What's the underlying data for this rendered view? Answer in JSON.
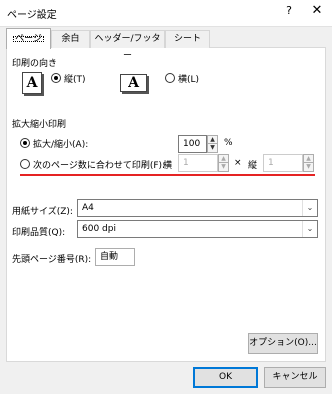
{
  "window": {
    "title": "ページ設定",
    "help": "?",
    "close": "✕"
  },
  "tabs": [
    {
      "label": "ページ"
    },
    {
      "label": "余白"
    },
    {
      "label": "ヘッダー/フッター"
    },
    {
      "label": "シート"
    }
  ],
  "orientation": {
    "heading": "印刷の向き",
    "portrait_icon": "A",
    "portrait_label": "縦(T)",
    "landscape_icon": "A",
    "landscape_label": "横(L)"
  },
  "scaling": {
    "heading": "拡大縮小印刷",
    "zoom_label": "拡大/縮小(A):",
    "zoom_value": "100",
    "zoom_unit": "%",
    "fit_label": "次のページ数に合わせて印刷(F):",
    "wide_label": "横",
    "wide_value": "1",
    "times": "×",
    "tall_label": "縦",
    "tall_value": "1"
  },
  "paper": {
    "label": "用紙サイズ(Z):",
    "value": "A4"
  },
  "quality": {
    "label": "印刷品質(Q):",
    "value": "600 dpi"
  },
  "first_page": {
    "label": "先頭ページ番号(R):",
    "value": "自動"
  },
  "buttons": {
    "options": "オプション(O)...",
    "ok": "OK",
    "cancel": "キャンセル"
  },
  "icons": {
    "spin_up": "▲",
    "spin_down": "▼",
    "dropdown": "⌄"
  },
  "colors": {
    "accent": "#0078d7",
    "highlight_line": "#e52323"
  }
}
